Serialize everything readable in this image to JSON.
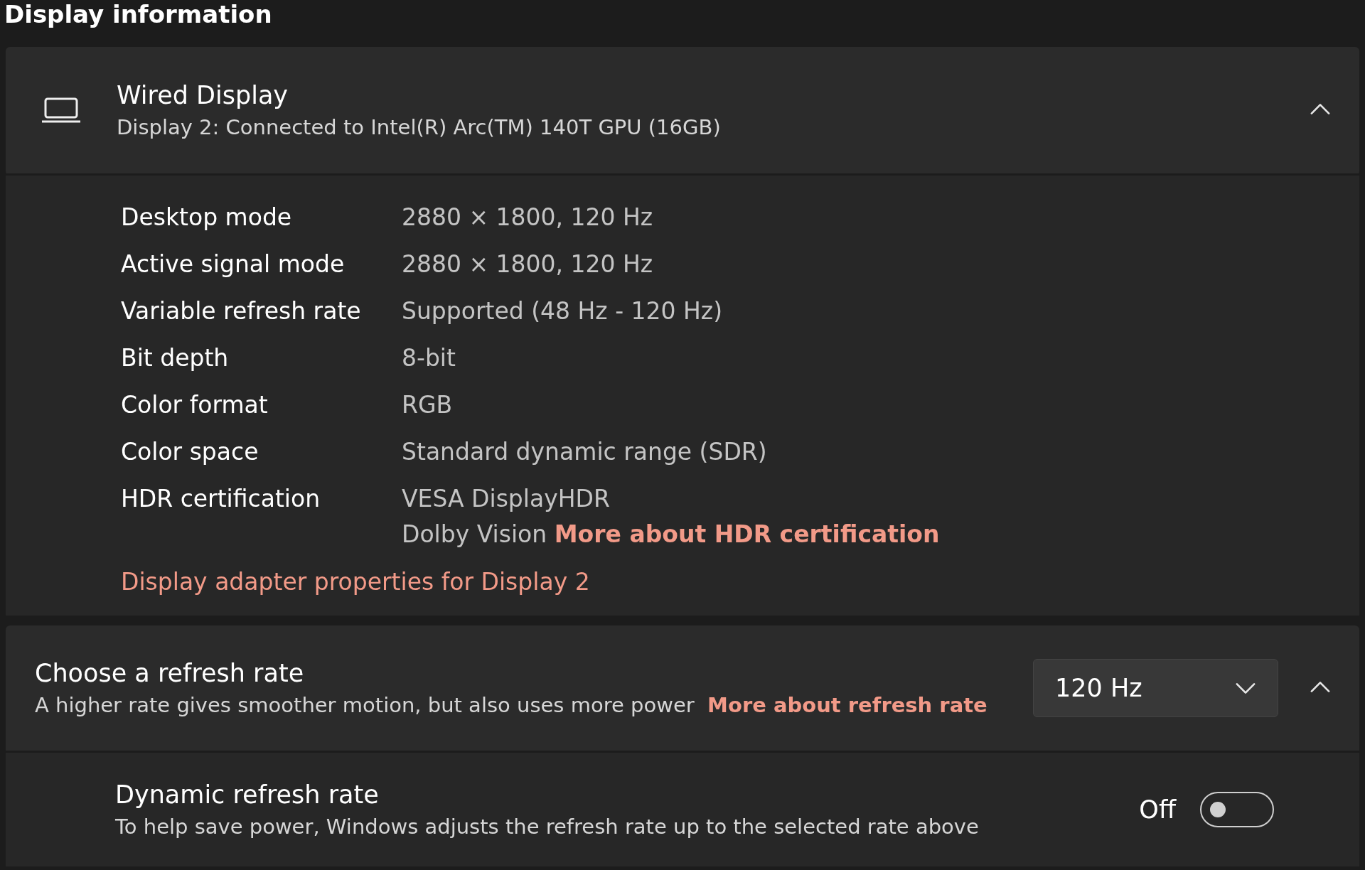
{
  "section_title": "Display information",
  "display": {
    "name": "Wired Display",
    "subtitle": "Display 2: Connected to Intel(R) Arc(TM) 140T GPU (16GB)",
    "expanded": true,
    "properties": [
      {
        "label": "Desktop mode",
        "values": [
          "2880 × 1800, 120 Hz"
        ]
      },
      {
        "label": "Active signal mode",
        "values": [
          "2880 × 1800, 120 Hz"
        ]
      },
      {
        "label": "Variable refresh rate",
        "values": [
          "Supported (48 Hz - 120 Hz)"
        ]
      },
      {
        "label": "Bit depth",
        "values": [
          "8-bit"
        ]
      },
      {
        "label": "Color format",
        "values": [
          "RGB"
        ]
      },
      {
        "label": "Color space",
        "values": [
          "Standard dynamic range (SDR)"
        ]
      },
      {
        "label": "HDR certification",
        "values": [
          "VESA DisplayHDR",
          "Dolby Vision"
        ],
        "link": "More about HDR certification"
      }
    ],
    "adapter_link": "Display adapter properties for Display 2"
  },
  "refresh_rate": {
    "title": "Choose a refresh rate",
    "description": "A higher rate gives smoother motion, but also uses more power",
    "link": "More about refresh rate",
    "dropdown": {
      "value": "120 Hz"
    },
    "expanded": true
  },
  "dynamic_refresh": {
    "title": "Dynamic refresh rate",
    "description": "To help save power, Windows adjusts the refresh rate up to the selected rate above",
    "state_label": "Off",
    "on": false
  }
}
